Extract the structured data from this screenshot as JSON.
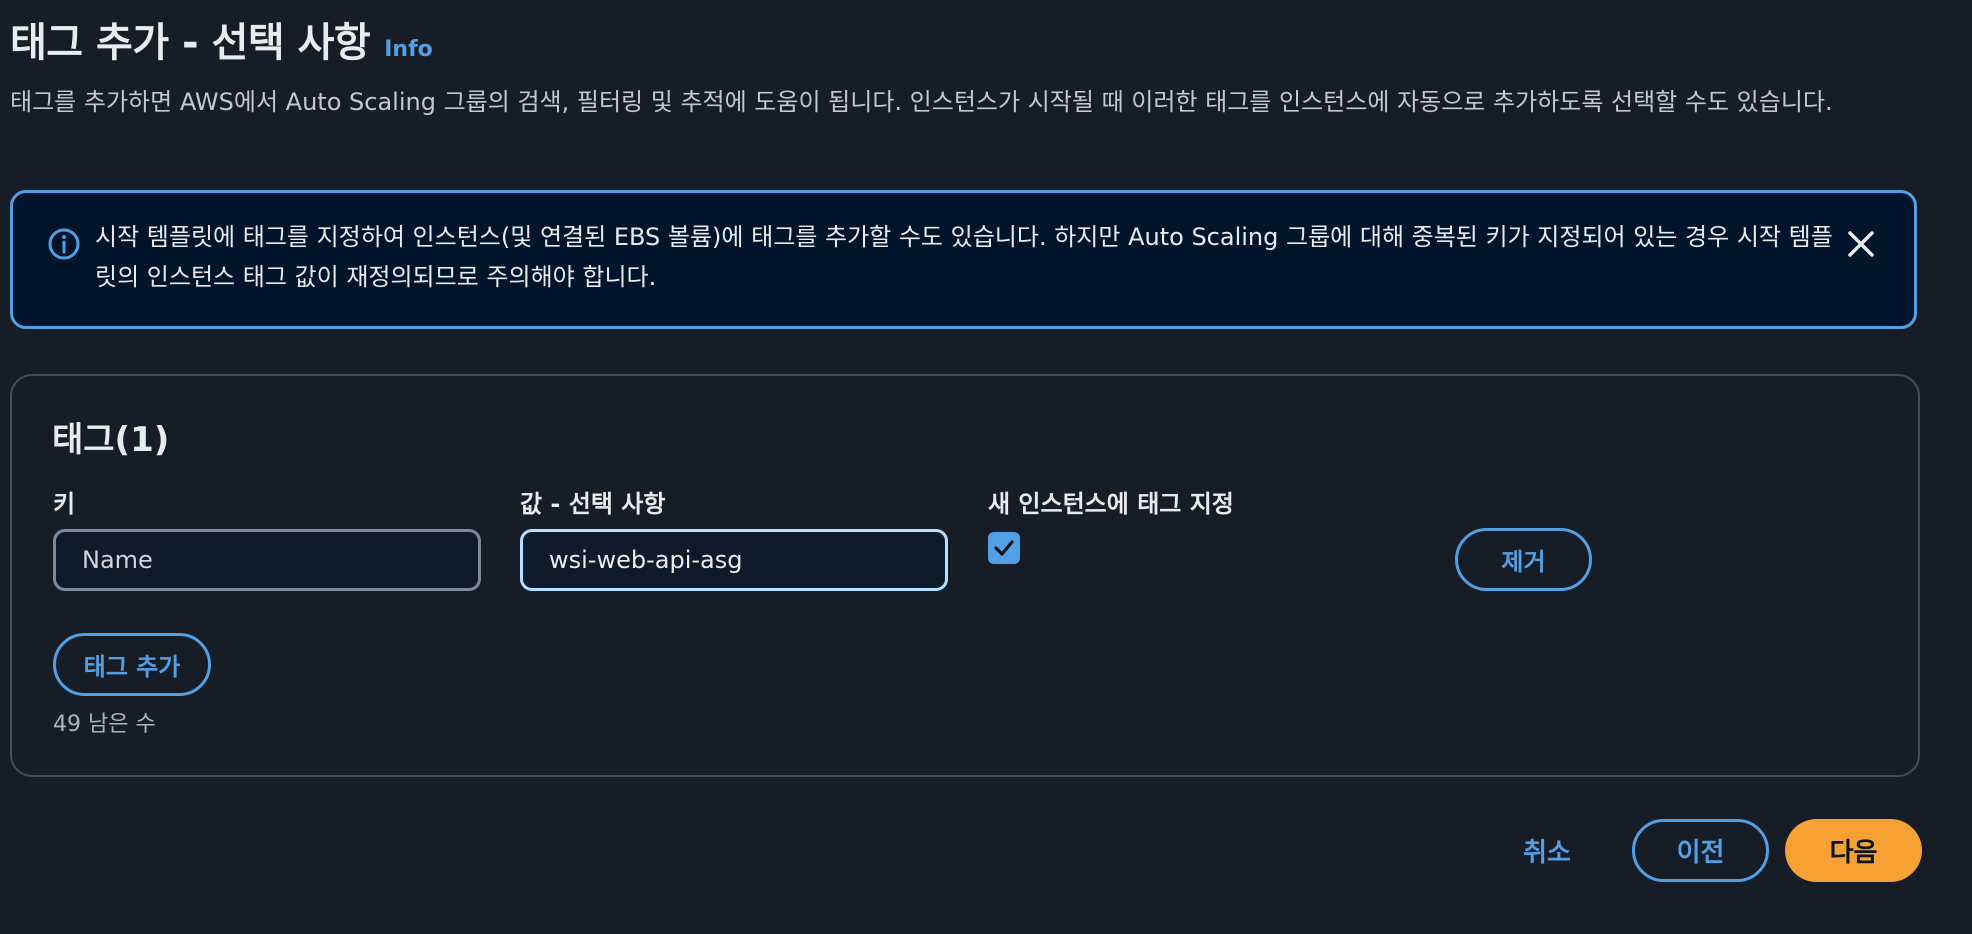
{
  "header": {
    "title": "태그 추가 - 선택 사항",
    "info_link": "Info",
    "description": "태그를 추가하면 AWS에서 Auto Scaling 그룹의 검색, 필터링 및 추적에 도움이 됩니다. 인스턴스가 시작될 때 이러한 태그를 인스턴스에 자동으로 추가하도록 선택할 수도 있습니다."
  },
  "alert": {
    "text": "시작 템플릿에 태그를 지정하여 인스턴스(및 연결된 EBS 볼륨)에 태그를 추가할 수도 있습니다. 하지만 Auto Scaling 그룹에 대해 중복된 키가 지정되어 있는 경우 시작 템플릿의 인스턴스 태그 값이 재정의되므로 주의해야 합니다.",
    "info_icon": "info-circle-icon",
    "close_icon": "close-icon"
  },
  "tags": {
    "title": "태그(1)",
    "key_label": "키",
    "value_label": "값 - 선택 사항",
    "propagate_label": "새 인스턴스에 태그 지정",
    "rows": [
      {
        "key": "Name",
        "value": "wsi-web-api-asg",
        "propagate": true,
        "remove_label": "제거"
      }
    ],
    "add_tag_label": "태그 추가",
    "remaining": "49 남은 수"
  },
  "footer": {
    "cancel_label": "취소",
    "previous_label": "이전",
    "next_label": "다음"
  },
  "colors": {
    "background": "#161d26",
    "accent": "#539fe5",
    "primary_button": "#f5a133",
    "alert_background": "#00142b"
  }
}
